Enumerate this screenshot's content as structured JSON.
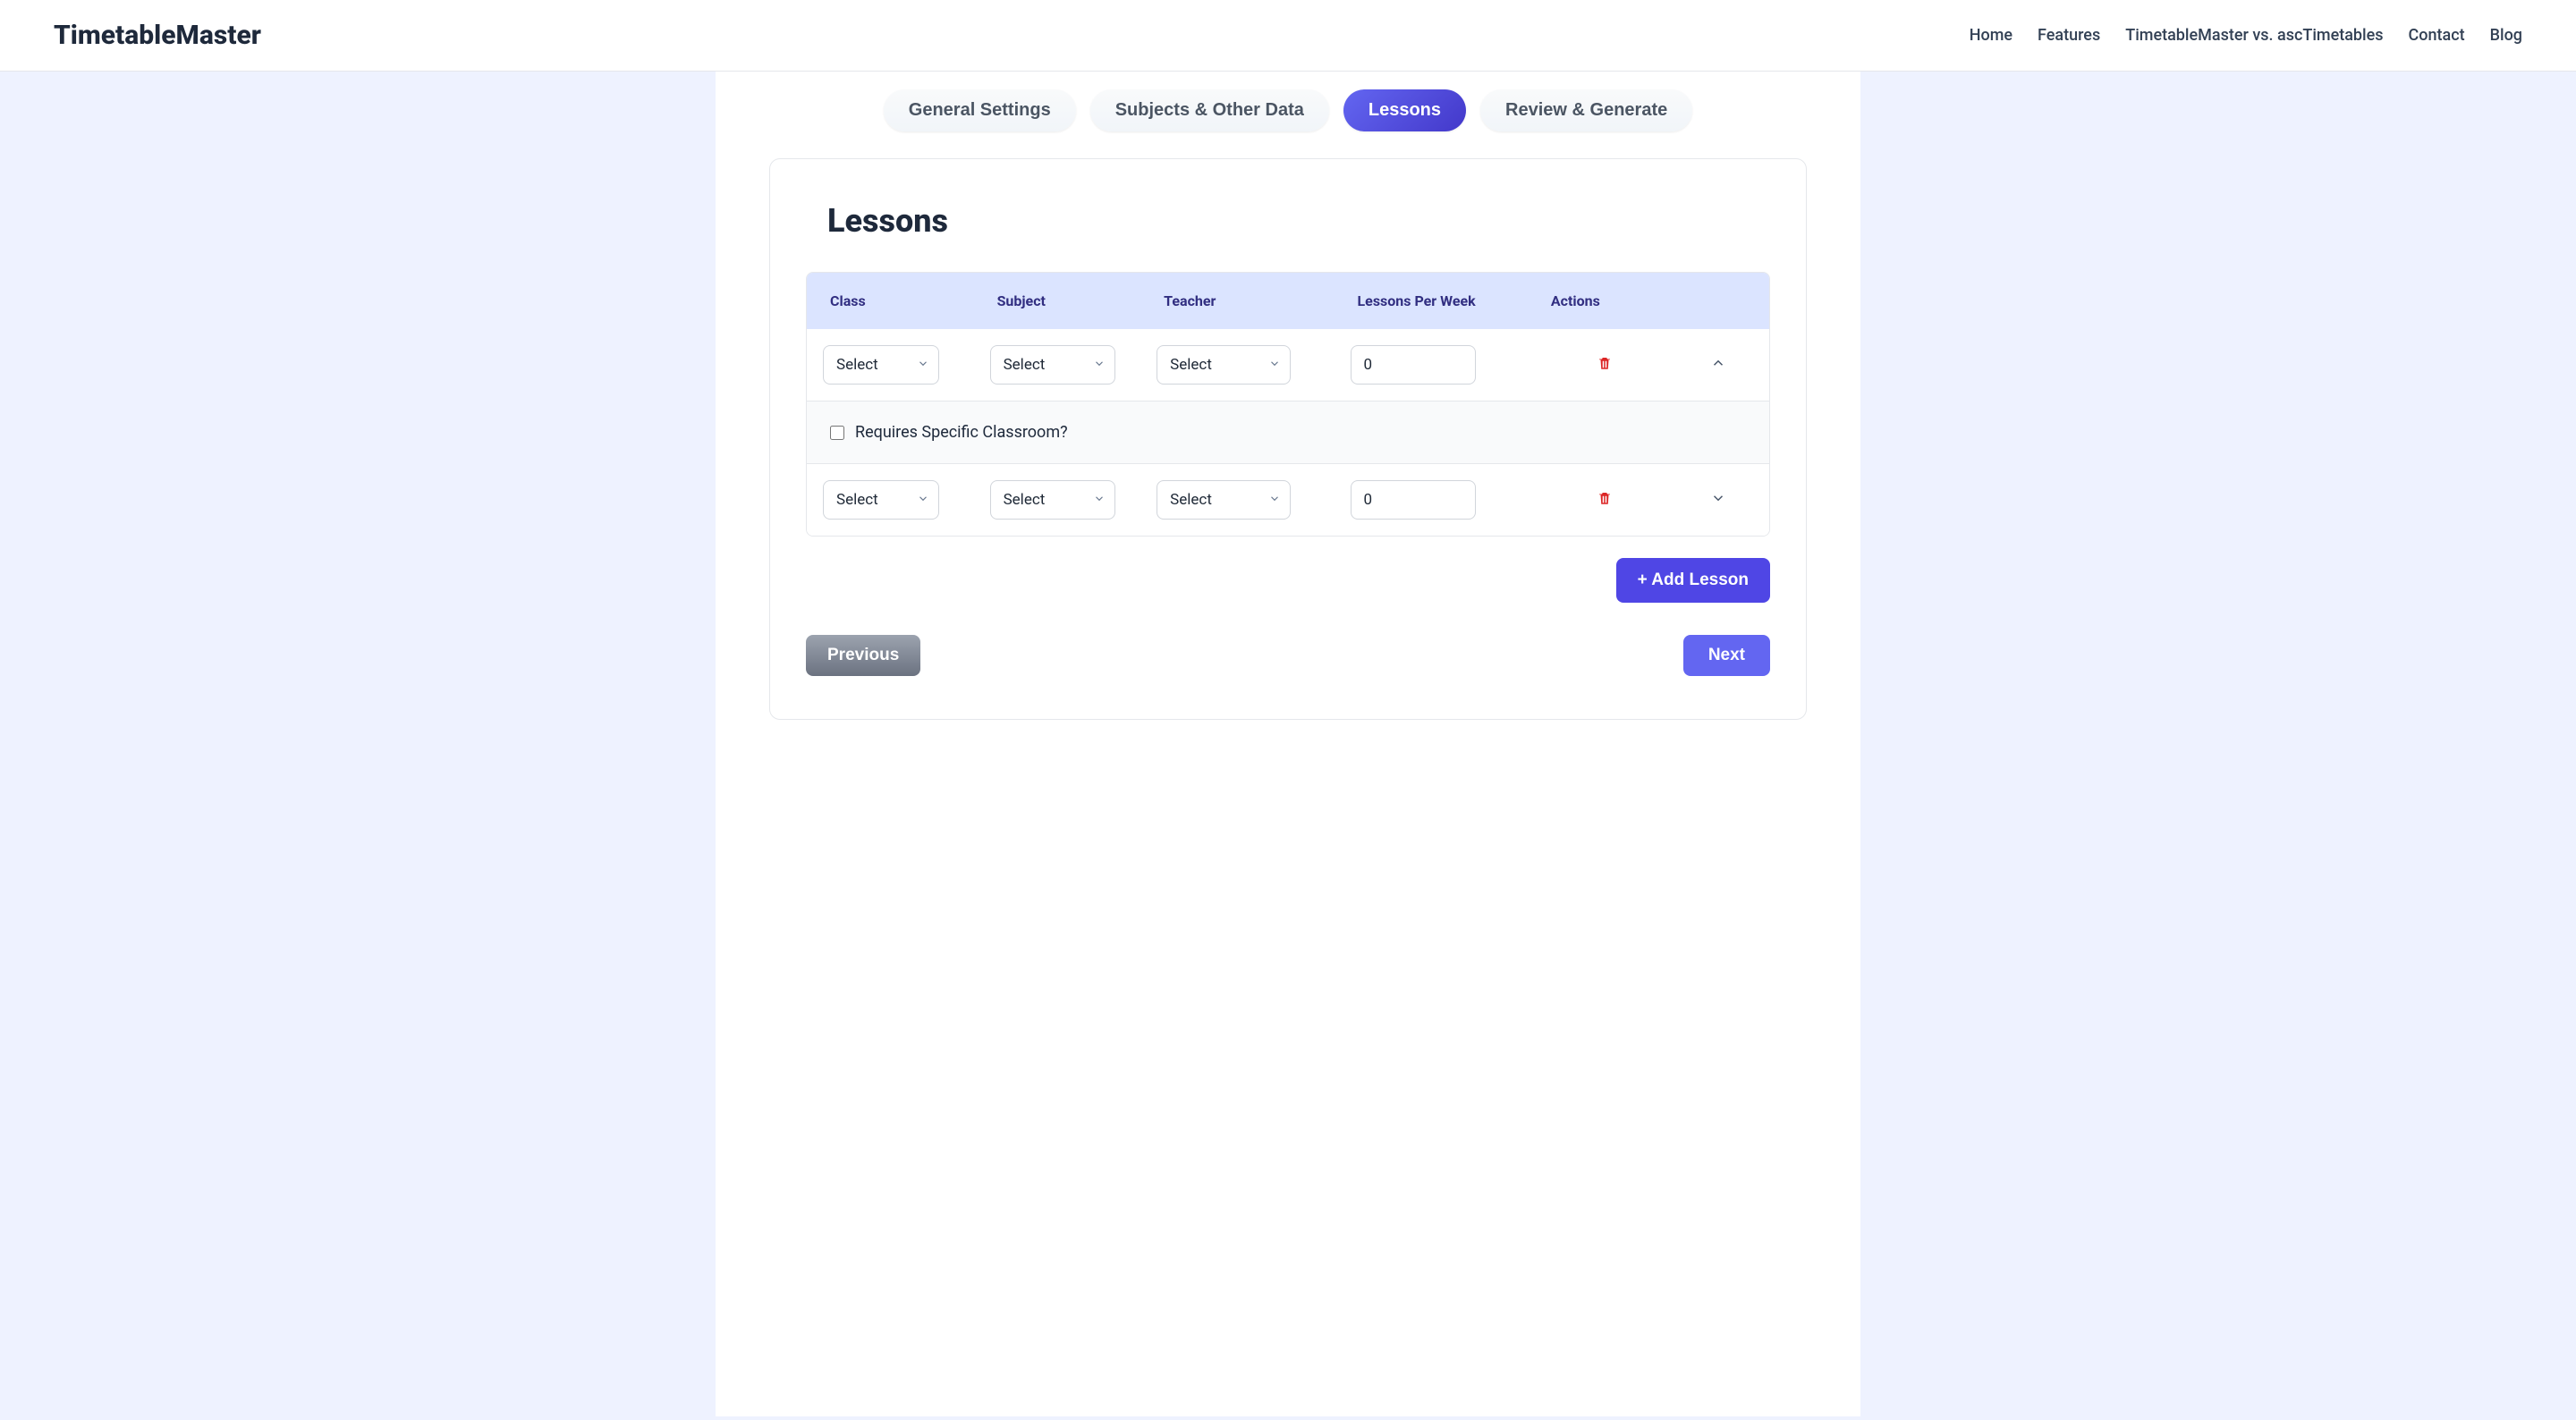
{
  "header": {
    "brand": "TimetableMaster",
    "nav": [
      "Home",
      "Features",
      "TimetableMaster vs. ascTimetables",
      "Contact",
      "Blog"
    ]
  },
  "tabs": {
    "items": [
      "General Settings",
      "Subjects & Other Data",
      "Lessons",
      "Review & Generate"
    ],
    "active_index": 2
  },
  "panel": {
    "title": "Lessons",
    "columns": [
      "Class",
      "Subject",
      "Teacher",
      "Lessons Per Week",
      "Actions"
    ],
    "rows": [
      {
        "class_select": "Select",
        "subject_select": "Select",
        "teacher_select": "Select",
        "lessons_per_week": "0",
        "expanded": true
      },
      {
        "class_select": "Select",
        "subject_select": "Select",
        "teacher_select": "Select",
        "lessons_per_week": "0",
        "expanded": false
      }
    ],
    "expand_section": {
      "checkbox_label": "Requires Specific Classroom?"
    },
    "add_button": "+ Add Lesson",
    "prev_button": "Previous",
    "next_button": "Next"
  }
}
